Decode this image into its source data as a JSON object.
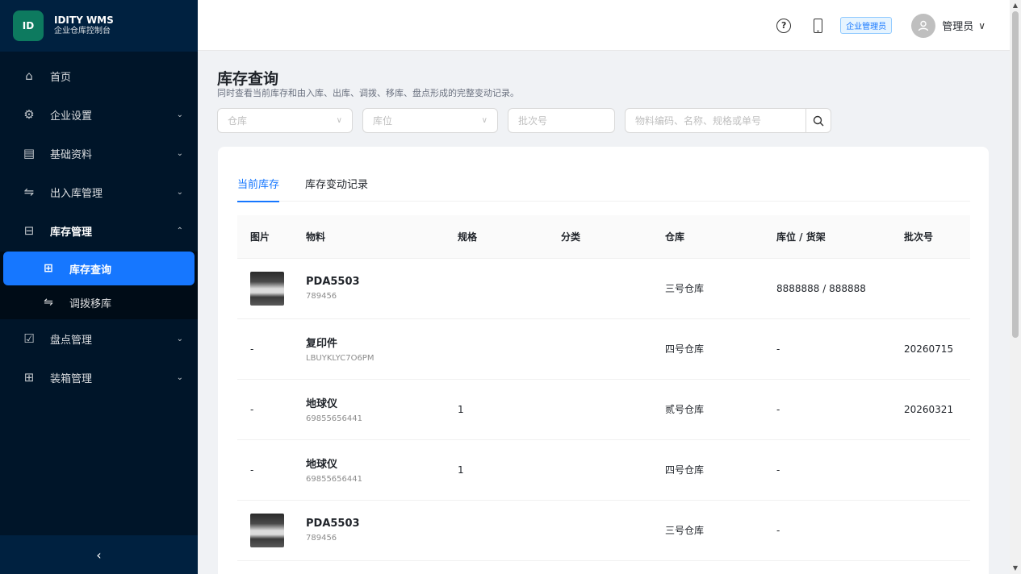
{
  "brand": {
    "logo": "ID",
    "title": "IDITY WMS",
    "subtitle": "企业仓库控制台"
  },
  "sidebar": {
    "items": [
      {
        "label": "首页",
        "icon": "home-icon",
        "glyph": "⌂"
      },
      {
        "label": "企业设置",
        "icon": "gear-icon",
        "glyph": "⚙"
      },
      {
        "label": "基础资料",
        "icon": "doc-icon",
        "glyph": "▤"
      },
      {
        "label": "出入库管理",
        "icon": "swap-icon",
        "glyph": "⇋"
      },
      {
        "label": "库存管理",
        "icon": "inbox-icon",
        "glyph": "⊟"
      },
      {
        "label": "盘点管理",
        "icon": "check-square-icon",
        "glyph": "☑"
      },
      {
        "label": "装箱管理",
        "icon": "gift-icon",
        "glyph": "⊞"
      }
    ],
    "sub_items": [
      {
        "label": "库存查询",
        "icon": "table-icon",
        "glyph": "⊞"
      },
      {
        "label": "调拨移库",
        "icon": "swap-icon",
        "glyph": "⇋"
      }
    ],
    "collapse_glyph": "‹"
  },
  "header": {
    "help_glyph": "?",
    "role_tag": "企业管理员",
    "user_name": "管理员",
    "chevron": "∨"
  },
  "page": {
    "title": "库存查询",
    "description": "同时查看当前库存和由入库、出库、调拨、移库、盘点形成的完整变动记录。"
  },
  "filters": {
    "warehouse_placeholder": "仓库",
    "location_placeholder": "库位",
    "batch_placeholder": "批次号",
    "search_placeholder": "物料编码、名称、规格或单号"
  },
  "tabs": [
    "当前库存",
    "库存变动记录"
  ],
  "table": {
    "columns": [
      "图片",
      "物料",
      "规格",
      "分类",
      "仓库",
      "库位 / 货架",
      "批次号"
    ],
    "rows": [
      {
        "image": "",
        "name": "PDA5503",
        "code": "789456",
        "spec": "",
        "category": "",
        "warehouse": "三号仓库",
        "location": "8888888 / 888888",
        "batch": ""
      },
      {
        "image": "-",
        "name": "复印件",
        "code": "LBUYKLYC7O6PM",
        "spec": "",
        "category": "",
        "warehouse": "四号仓库",
        "location": "-",
        "batch": "20260715"
      },
      {
        "image": "-",
        "name": "地球仪",
        "code": "69855656441",
        "spec": "1",
        "category": "",
        "warehouse": "贰号仓库",
        "location": "-",
        "batch": "20260321"
      },
      {
        "image": "-",
        "name": "地球仪",
        "code": "69855656441",
        "spec": "1",
        "category": "",
        "warehouse": "四号仓库",
        "location": "-",
        "batch": ""
      },
      {
        "image": "",
        "name": "PDA5503",
        "code": "789456",
        "spec": "",
        "category": "",
        "warehouse": "三号仓库",
        "location": "-",
        "batch": ""
      }
    ]
  },
  "colors": {
    "sidebar_bg": "#001529",
    "accent": "#1677ff",
    "logo_bg": "#0d7a5f"
  }
}
